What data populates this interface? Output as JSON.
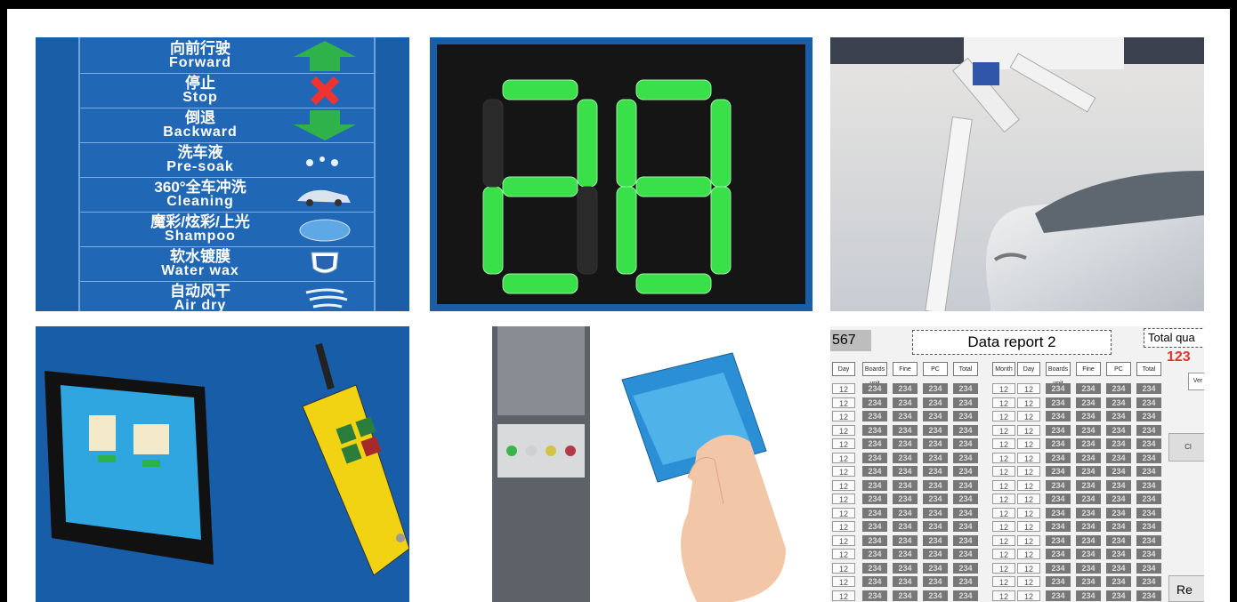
{
  "guide": {
    "rows": [
      {
        "zh": "向前行驶",
        "en": "Forward",
        "icon": "up-arrow-icon"
      },
      {
        "zh": "停止",
        "en": "Stop",
        "icon": "red-x-icon"
      },
      {
        "zh": "倒退",
        "en": "Backward",
        "icon": "down-arrow-icon"
      },
      {
        "zh": "洗车液",
        "en": "Pre-soak",
        "icon": "droplets-icon"
      },
      {
        "zh": "360°全车冲洗",
        "en": "Cleaning",
        "icon": "car-wash-icon"
      },
      {
        "zh": "魔彩/炫彩/上光",
        "en": "Shampoo",
        "icon": "foam-icon"
      },
      {
        "zh": "软水镀膜",
        "en": "Water wax",
        "icon": "shield-icon"
      },
      {
        "zh": "自动风干",
        "en": "Air dry",
        "icon": "wind-icon"
      }
    ]
  },
  "digits": {
    "display": "28",
    "color": "#39e04a"
  },
  "report": {
    "id_fragment": "567",
    "title": "Data report 2",
    "total_label": "Total qua",
    "total_value": "123",
    "version_btn": "Ver",
    "clear_btn": "Cl",
    "return_btn": "Re",
    "headers": [
      "Day",
      "Boards unit",
      "Fine",
      "PC",
      "Total",
      "Month",
      "Day",
      "Boards unit",
      "Fine",
      "PC",
      "Total"
    ],
    "cell_a": "12",
    "cell_b": "234"
  },
  "colors": {
    "panel_blue": "#1a5ea8",
    "frame": "#000000",
    "led_green": "#39e04a"
  }
}
